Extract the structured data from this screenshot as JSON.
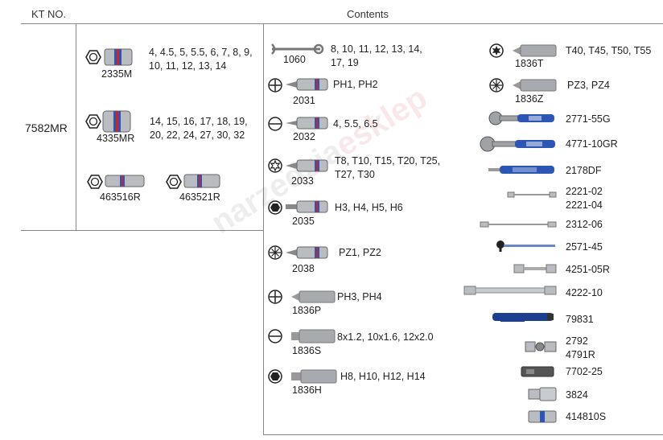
{
  "header": {
    "kt_no": "KT NO.",
    "contents": "Contents"
  },
  "kit_number": "7582MR",
  "watermark": {
    "part1": "narzedzia",
    "part2": "esklep"
  },
  "colors": {
    "tool_blue": "#2d55b5",
    "tool_red": "#c62828",
    "chrome": "#b9bdc2"
  },
  "sockets": [
    {
      "code": "2335M",
      "sizes_line1": "4, 4.5, 5, 5.5, 6, 7, 8, 9,",
      "sizes_line2": "10, 11, 12, 13, 14"
    },
    {
      "code": "4335MR",
      "sizes_line1": "14, 15, 16, 17, 18, 19,",
      "sizes_line2": "20, 22, 24, 27, 30, 32"
    },
    {
      "code": "463516R"
    },
    {
      "code": "463521R"
    }
  ],
  "middle": [
    {
      "code": "1060",
      "icon": "wrench-icon",
      "text1": "8, 10, 11, 12, 13, 14,",
      "text2": "17, 19"
    },
    {
      "code": "2031",
      "icon": "phillips-icon",
      "text1": "PH1, PH2"
    },
    {
      "code": "2032",
      "icon": "slotted-icon",
      "text1": "4, 5.5, 6.5"
    },
    {
      "code": "2033",
      "icon": "torx-icon",
      "text1": "T8, T10, T15, T20, T25,",
      "text2": "T27, T30"
    },
    {
      "code": "2035",
      "icon": "hex-icon",
      "text1": "H3, H4, H5, H6"
    },
    {
      "code": "2038",
      "icon": "pozidriv-icon",
      "text1": "PZ1, PZ2"
    },
    {
      "code": "1836P",
      "icon": "phillips-icon",
      "text1": "PH3, PH4"
    },
    {
      "code": "1836S",
      "icon": "slotted-icon",
      "text1": "8x1.2, 10x1.6, 12x2.0"
    },
    {
      "code": "1836H",
      "icon": "hex-icon",
      "text1": "H8, H10, H12, H14"
    }
  ],
  "right_bits": [
    {
      "code": "1836T",
      "icon": "torx-icon",
      "text": "T40, T45, T50, T55"
    },
    {
      "code": "1836Z",
      "icon": "pozidriv-icon",
      "text": "PZ3, PZ4"
    }
  ],
  "right_tools": [
    {
      "code": "2771-55G",
      "tool": "ratchet"
    },
    {
      "code": "4771-10GR",
      "tool": "ratchet"
    },
    {
      "code": "2178DF",
      "tool": "driver-handle"
    },
    {
      "code": "2221-02",
      "code2": "2221-04",
      "tool": "extension"
    },
    {
      "code": "2312-06",
      "tool": "flex-bar"
    },
    {
      "code": "2571-45",
      "tool": "spinner"
    },
    {
      "code": "4251-05R",
      "tool": "extension"
    },
    {
      "code": "4222-10",
      "tool": "long-extension"
    },
    {
      "code": "79831",
      "tool": "penlight"
    },
    {
      "code": "2792",
      "code2": "4791R",
      "tool": "universal-joint"
    },
    {
      "code": "7702-25",
      "tool": "bit-adapter"
    },
    {
      "code": "3824",
      "tool": "adapter"
    },
    {
      "code": "414810S",
      "tool": "bit-holder-socket"
    }
  ]
}
